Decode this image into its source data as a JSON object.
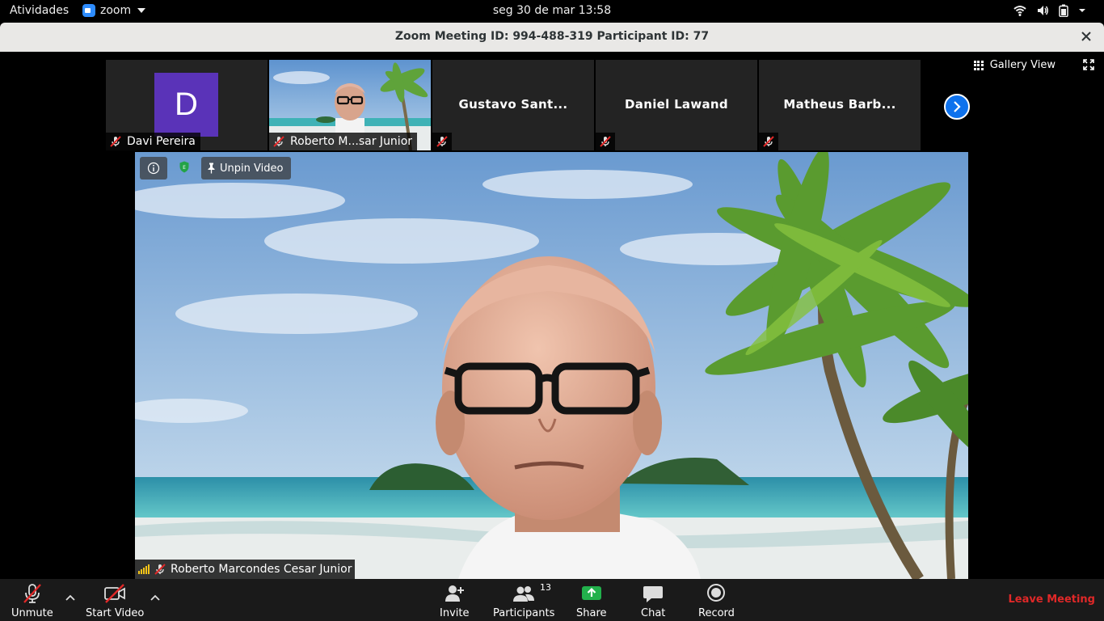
{
  "system_bar": {
    "activities": "Atividades",
    "app_name": "zoom",
    "clock": "seg 30 de mar  13:58"
  },
  "window": {
    "title": "Zoom Meeting ID: 994-488-319 Participant ID: 77"
  },
  "view": {
    "gallery_label": "Gallery View"
  },
  "participants_strip": [
    {
      "name": "Davi Pereira",
      "avatar_letter": "D",
      "muted": true
    },
    {
      "name": "Roberto M...sar Junior",
      "video": true,
      "muted": true
    },
    {
      "name": "Gustavo Sant...",
      "muted": true
    },
    {
      "name": "Daniel Lawand",
      "muted": true
    },
    {
      "name": "Matheus Barb...",
      "muted": true
    }
  ],
  "main_video": {
    "unpin_label": "Unpin Video",
    "speaker_name": "Roberto Marcondes Cesar Junior"
  },
  "toolbar": {
    "unmute": "Unmute",
    "start_video": "Start Video",
    "invite": "Invite",
    "participants": "Participants",
    "participants_count": "13",
    "share": "Share",
    "chat": "Chat",
    "record": "Record",
    "leave": "Leave Meeting"
  },
  "colors": {
    "accent_blue": "#0e72ed",
    "avatar_purple": "#5a33b8",
    "leave_red": "#e02828",
    "share_green": "#22b14c"
  }
}
